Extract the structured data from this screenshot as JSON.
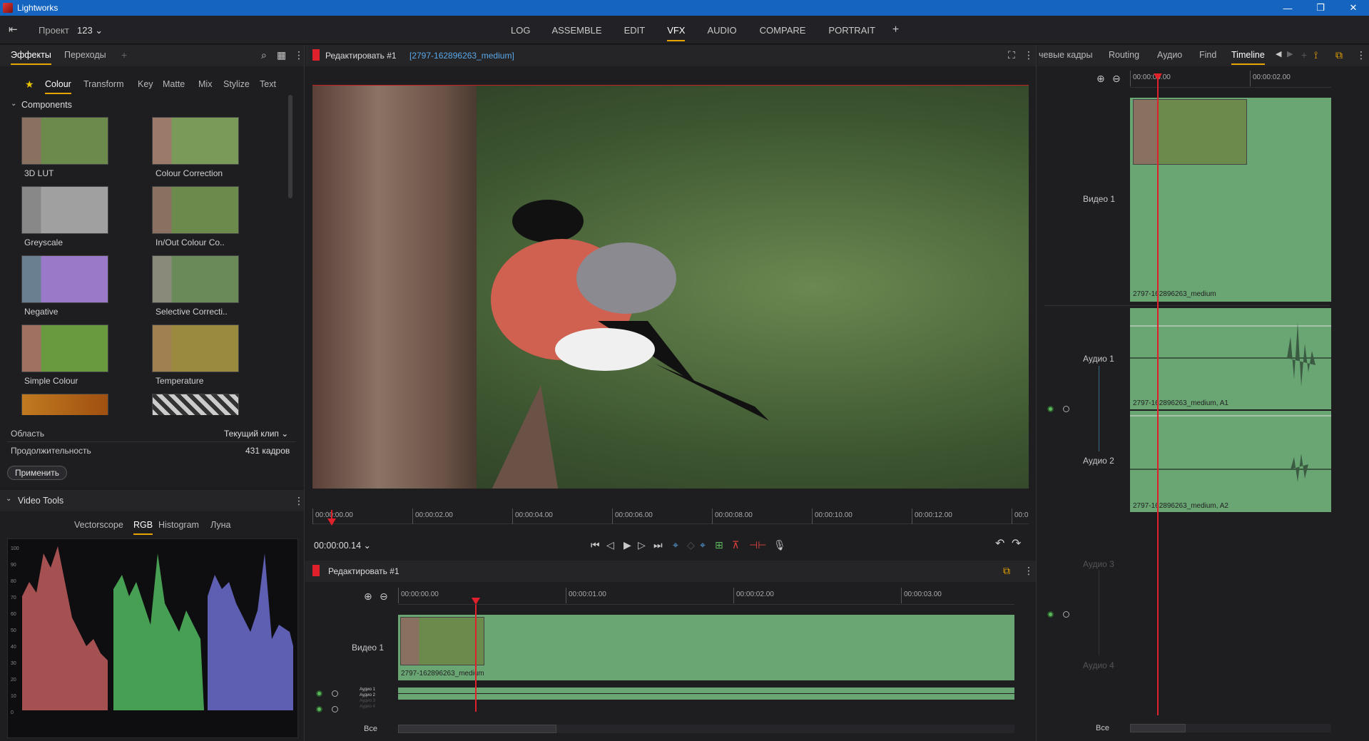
{
  "window": {
    "title": "Lightworks",
    "minimize": "—",
    "restore": "❐",
    "close": "✕"
  },
  "topbar": {
    "project_label": "Проект",
    "project_value": "123 ⌄",
    "tabs": [
      "LOG",
      "ASSEMBLE",
      "EDIT",
      "VFX",
      "AUDIO",
      "COMPARE",
      "PORTRAIT"
    ],
    "active_tab": "VFX",
    "add": "+"
  },
  "effects": {
    "tabs": [
      "Эффекты",
      "Переходы"
    ],
    "categories": [
      "Colour",
      "Transform",
      "Key",
      "Matte",
      "Mix",
      "Stylize",
      "Text"
    ],
    "section": "Components",
    "items": [
      "3D LUT",
      "Colour Correction",
      "Greyscale",
      "In/Out Colour Co..",
      "Negative",
      "Selective Correcti..",
      "Simple Colour",
      "Temperature"
    ],
    "area_label": "Область",
    "area_value": "Текущий клип ⌄",
    "duration_label": "Продолжительность",
    "duration_value": "431 кадров",
    "apply_button": "Применить"
  },
  "video_tools": {
    "title": "Video Tools",
    "tabs": [
      "Vectorscope",
      "RGB",
      "Histogram",
      "Луна"
    ],
    "active": "RGB",
    "scale": [
      "100",
      "90",
      "80",
      "70",
      "60",
      "50",
      "40",
      "30",
      "20",
      "10",
      "0"
    ]
  },
  "viewer": {
    "title": "Редактировать #1",
    "clip": "[2797-162896263_medium]",
    "ruler": [
      "00:00:00.00",
      "00:00:02.00",
      "00:00:04.00",
      "00:00:06.00",
      "00:00:08.00",
      "00:00:10.00",
      "00:00:12.00",
      "00:0"
    ],
    "timecode": "00:00:00.14 ⌄"
  },
  "edit_timeline": {
    "title": "Редактировать #1",
    "ruler": [
      "00:00:00.00",
      "00:00:01.00",
      "00:00:02.00",
      "00:00:03.00"
    ],
    "video_track": "Видео 1",
    "clip_name": "2797-162896263_medium",
    "audio_tracks": [
      "Аудио 1",
      "Аудио 2",
      "Аудио 3",
      "Аудио 4"
    ],
    "all": "Все"
  },
  "right": {
    "tabs": [
      "чевые кадры",
      "Routing",
      "Аудио",
      "Find",
      "Timeline"
    ],
    "active": "Timeline",
    "ruler": [
      "00:00:00.00",
      "00:00:02.00"
    ],
    "tracks": {
      "video": "Видео 1",
      "a1": "Аудио 1",
      "a2": "Аудио 2",
      "a3": "Аудио 3",
      "a4": "Аудио 4"
    },
    "clip_video": "2797-162896263_medium",
    "clip_a1": "2797-162896263_medium, A1",
    "clip_a2": "2797-162896263_medium, A2",
    "all": "Все"
  },
  "colors": {
    "accent": "#e8a400",
    "playhead": "#e0202a",
    "clip": "#6aa674"
  }
}
